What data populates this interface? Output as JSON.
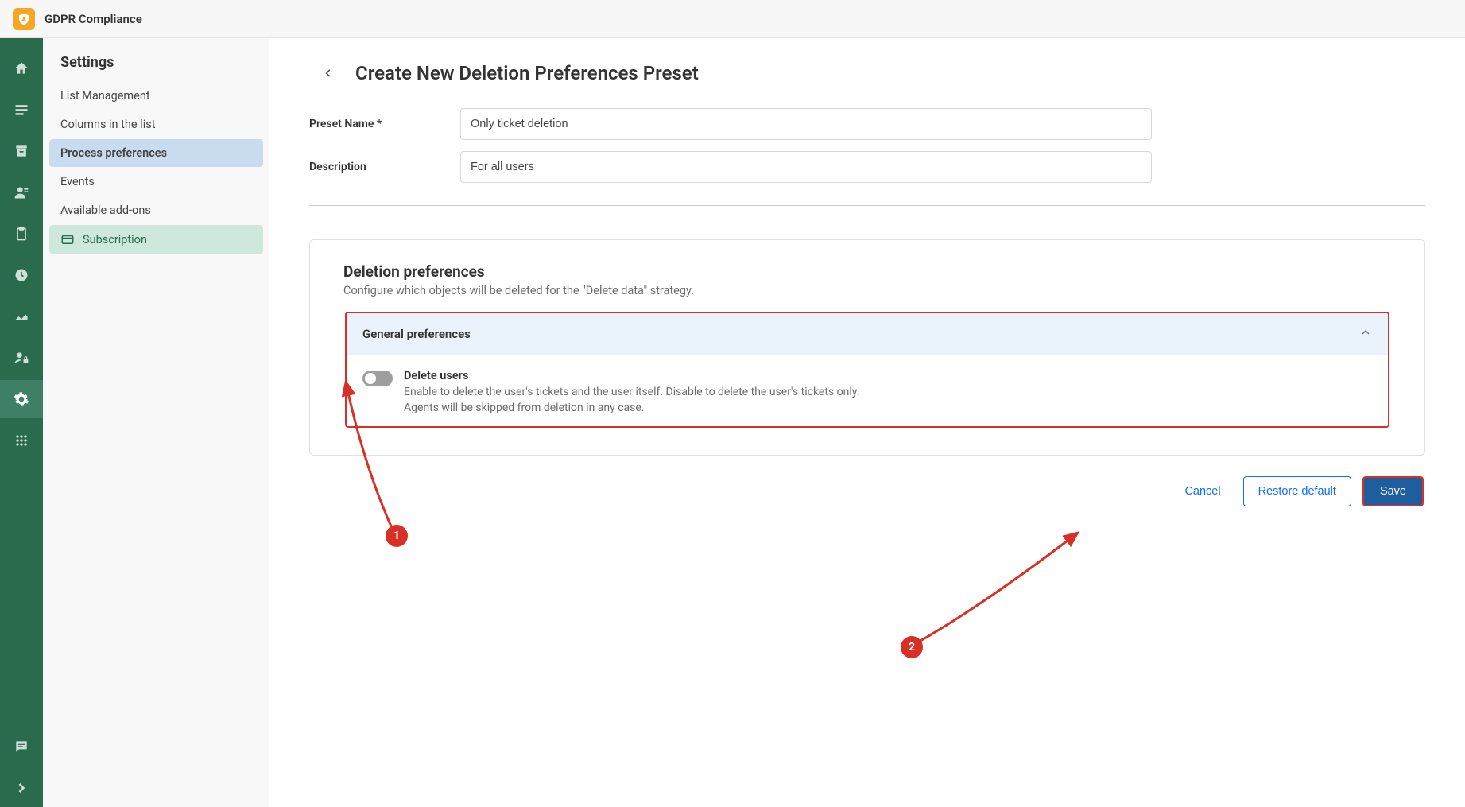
{
  "header": {
    "app_title": "GDPR Compliance"
  },
  "settings": {
    "title": "Settings",
    "items": [
      {
        "label": "List Management"
      },
      {
        "label": "Columns in the list"
      },
      {
        "label": "Process preferences"
      },
      {
        "label": "Events"
      },
      {
        "label": "Available add-ons"
      },
      {
        "label": "Subscription"
      }
    ]
  },
  "page": {
    "title": "Create New Deletion Preferences Preset",
    "preset_name_label": "Preset Name *",
    "preset_name_value": "Only ticket deletion",
    "description_label": "Description",
    "description_value": "For all users"
  },
  "deletion_prefs": {
    "title": "Deletion preferences",
    "subtitle": "Configure which objects will be deleted for the \"Delete data\" strategy.",
    "accordion_label": "General preferences",
    "toggle_title": "Delete users",
    "toggle_desc_line1": "Enable to delete the user's tickets and the user itself. Disable to delete the user's tickets only.",
    "toggle_desc_line2": "Agents will be skipped from deletion in any case."
  },
  "actions": {
    "cancel": "Cancel",
    "restore_default": "Restore default",
    "save": "Save"
  },
  "annotations": {
    "badge1": "1",
    "badge2": "2"
  }
}
